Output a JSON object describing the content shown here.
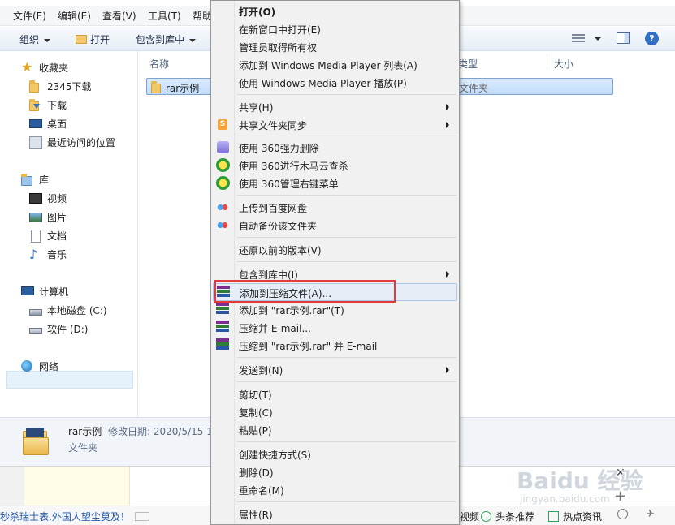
{
  "menubar": {
    "file": "文件(E)",
    "edit": "编辑(E)",
    "view": "查看(V)",
    "tools": "工具(T)",
    "help": "帮助"
  },
  "toolbar": {
    "organize": "组织",
    "open": "打开",
    "include_in_library": "包含到库中"
  },
  "nav": {
    "favorites": "收藏夹",
    "fav_2345": "2345下载",
    "downloads": "下载",
    "desktop": "桌面",
    "recent": "最近访问的位置",
    "libraries": "库",
    "videos": "视频",
    "pictures": "图片",
    "documents": "文档",
    "music": "音乐",
    "computer": "计算机",
    "drive_c": "本地磁盘 (C:)",
    "drive_d": "软件 (D:)",
    "network": "网络"
  },
  "content": {
    "col_name": "名称",
    "col_type": "类型",
    "col_size": "大小",
    "row_name": "rar示例",
    "row_type": "文件夹"
  },
  "details": {
    "name": "rar示例",
    "modified_label": "修改日期: 2020/5/15 1",
    "type": "文件夹"
  },
  "context_menu": {
    "open": "打开(O)",
    "open_new_window": "在新窗口中打开(E)",
    "take_ownership": "管理员取得所有权",
    "add_wmp_list": "添加到 Windows Media Player 列表(A)",
    "play_wmp": "使用 Windows Media Player 播放(P)",
    "share": "共享(H)",
    "share_sync": "共享文件夹同步",
    "shred_360": "使用 360强力删除",
    "scan_360": "使用 360进行木马云查杀",
    "manage_360": "使用 360管理右键菜单",
    "upload_baidu": "上传到百度网盘",
    "auto_backup": "自动备份该文件夹",
    "restore_prev": "还原以前的版本(V)",
    "include_library": "包含到库中(I)",
    "add_archive": "添加到压缩文件(A)...",
    "add_to_rar": "添加到 \"rar示例.rar\"(T)",
    "compress_email": "压缩并 E-mail...",
    "compress_rar_email": "压缩到 \"rar示例.rar\" 并 E-mail",
    "send_to": "发送到(N)",
    "cut": "剪切(T)",
    "copy": "复制(C)",
    "paste": "粘贴(P)",
    "create_shortcut": "创建快捷方式(S)",
    "delete": "删除(D)",
    "rename": "重命名(M)",
    "properties": "属性(R)"
  },
  "strip": {
    "news": "秒杀瑞士表,外国人望尘莫及！",
    "video": "视频",
    "headline": "头条推荐",
    "hot": "热点资讯"
  },
  "watermark": {
    "brand": "Baidu 经验",
    "url": "jingyan.baidu.com"
  },
  "colors": {
    "highlight_box": "#e23b3b",
    "selection": "#c1dcfb",
    "menu_bg": "#f1f1f1"
  }
}
